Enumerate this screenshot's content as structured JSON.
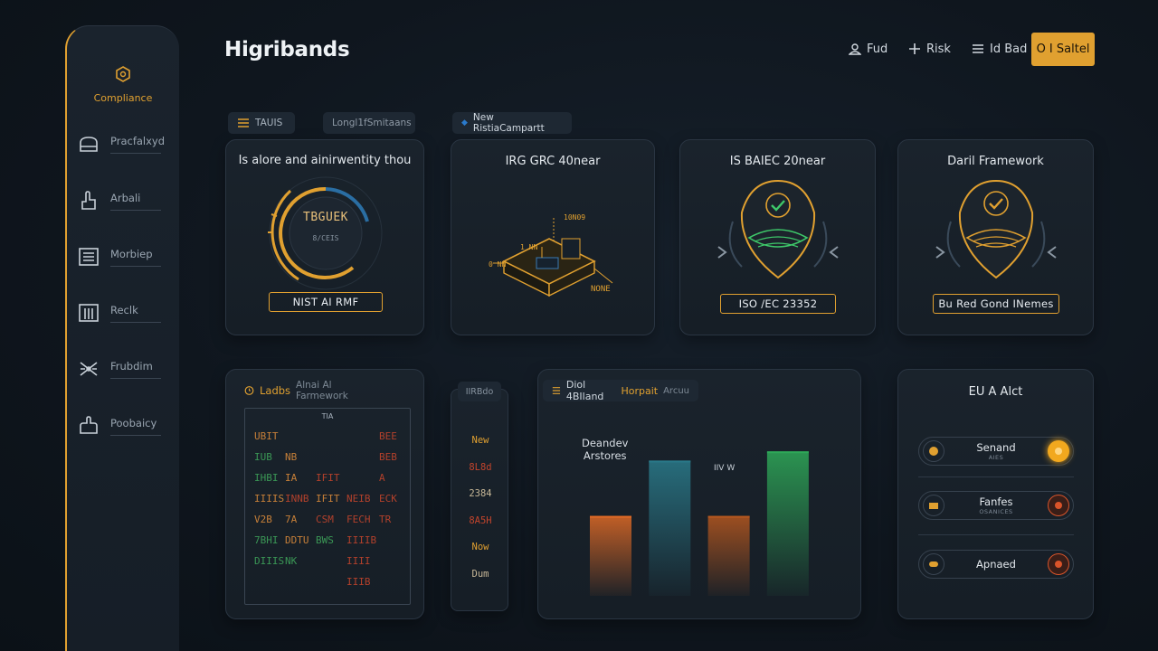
{
  "app": {
    "brand": "Higribands"
  },
  "sidebar": {
    "logo_label": "Compliance",
    "items": [
      {
        "label": "Pracfalxyd",
        "icon": "sofa-icon"
      },
      {
        "label": "Arbali",
        "icon": "hand-icon"
      },
      {
        "label": "Morbiep",
        "icon": "list-icon"
      },
      {
        "label": "Reclk",
        "icon": "bars-icon"
      },
      {
        "label": "Frubdim",
        "icon": "network-icon"
      },
      {
        "label": "Poobaicy",
        "icon": "hand-stop-icon"
      }
    ]
  },
  "topnav": {
    "items": [
      {
        "label": "Fud",
        "icon": "user-icon"
      },
      {
        "label": "Risk",
        "icon": "plus-icon"
      },
      {
        "label": "Id Bad",
        "icon": "menu-icon"
      }
    ],
    "signin_label": "O I Saltel"
  },
  "cards": {
    "nist": {
      "tab1": "TAUIS",
      "tab2": "Longl1fSmitaans",
      "title": "Is alore and ainirwentity thou",
      "gauge_main": "TBGUEK",
      "gauge_sub": "8/CEIS",
      "badge": "NIST AI RMF"
    },
    "irg": {
      "tab": "New RistiaCampartt",
      "title": "IRG GRC 40near",
      "labels": [
        "10N09",
        "1 NN",
        "0 NN",
        "NONE"
      ]
    },
    "isbaiec": {
      "title": "IS BAIEC 20near",
      "badge": "ISO /EC 23352"
    },
    "daril": {
      "title": "Daril Framework",
      "badge": "Bu Red Gond INemes"
    },
    "ladbs": {
      "tab": "Ladbs",
      "tab_sub": "Alnai Al Farmework",
      "table_header": "TIA",
      "rows": [
        [
          {
            "t": "UBIT",
            "c": "#d98a3a"
          },
          {
            "t": "",
            "c": "#d98a3a"
          },
          {
            "t": "",
            "c": "#d98a3a"
          },
          {
            "t": "",
            "c": "#d98a3a"
          },
          {
            "t": "BEE",
            "c": "#c2442c"
          }
        ],
        [
          {
            "t": "IUB",
            "c": "#3ea35a"
          },
          {
            "t": "NB",
            "c": "#d98a3a"
          },
          {
            "t": "",
            "c": "#d98a3a"
          },
          {
            "t": "",
            "c": "#d98a3a"
          },
          {
            "t": "BEB",
            "c": "#c2442c"
          }
        ],
        [
          {
            "t": "IHBI",
            "c": "#3ea35a"
          },
          {
            "t": "IA",
            "c": "#d98a3a"
          },
          {
            "t": "IFIT",
            "c": "#c2442c"
          },
          {
            "t": "",
            "c": "#d98a3a"
          },
          {
            "t": "A",
            "c": "#c2442c"
          }
        ],
        [
          {
            "t": "IIIIS",
            "c": "#d98a3a"
          },
          {
            "t": "INNB",
            "c": "#c2442c"
          },
          {
            "t": "IFIT",
            "c": "#d98a3a"
          },
          {
            "t": "NEIB",
            "c": "#c2442c"
          },
          {
            "t": "ECK",
            "c": "#c2442c"
          }
        ],
        [
          {
            "t": "V2B",
            "c": "#d98a3a"
          },
          {
            "t": "7A",
            "c": "#d98a3a"
          },
          {
            "t": "CSM",
            "c": "#c2442c"
          },
          {
            "t": "FECH",
            "c": "#c2442c"
          },
          {
            "t": "TR",
            "c": "#c2442c"
          }
        ],
        [
          {
            "t": "7BHI",
            "c": "#3ea35a"
          },
          {
            "t": "DDTU",
            "c": "#d98a3a"
          },
          {
            "t": "BWS",
            "c": "#3ea35a"
          },
          {
            "t": "IIIIB",
            "c": "#c2442c"
          },
          {
            "t": "",
            "c": "#c2442c"
          }
        ],
        [
          {
            "t": "DIIIS",
            "c": "#3ea35a"
          },
          {
            "t": "NK",
            "c": "#3ea35a"
          },
          {
            "t": "",
            "c": "#c2442c"
          },
          {
            "t": "IIII",
            "c": "#c2442c"
          },
          {
            "t": "",
            "c": "#c2442c"
          }
        ],
        [
          {
            "t": "",
            "c": "#c2442c"
          },
          {
            "t": "",
            "c": "#c2442c"
          },
          {
            "t": "",
            "c": "#c2442c"
          },
          {
            "t": "IIIB",
            "c": "#c2442c"
          },
          {
            "t": "",
            "c": "#c2442c"
          }
        ]
      ]
    },
    "col": {
      "tab": "IIRBdo",
      "items": [
        {
          "t": "New",
          "c": "#e0a030"
        },
        {
          "t": "8L8d",
          "c": "#c2442c"
        },
        {
          "t": "2384",
          "c": "#c8b898"
        },
        {
          "t": "8A5H",
          "c": "#c2442c"
        },
        {
          "t": "Now",
          "c": "#e0a030"
        },
        {
          "t": "Dum",
          "c": "#c8b898"
        }
      ]
    },
    "chart": {
      "tab": "Diol 4BIland",
      "tab_accent": "Horpait",
      "tab_tail": "Arcuu",
      "legend_l1": "Deandev",
      "legend_l2": "Arstores",
      "mid_label": "IIV W",
      "bars": [
        {
          "value": 0.52,
          "color": "#e06a26"
        },
        {
          "value": 0.88,
          "color": "#2a7a8a"
        },
        {
          "value": 0.52,
          "color": "#b5571f"
        },
        {
          "value": 0.94,
          "color": "#2ea858"
        }
      ]
    },
    "eu": {
      "title": "EU A Alct",
      "alerts": [
        {
          "main": "Senand",
          "sub": "AIES",
          "left_color": "#e0a030",
          "right_color": "#f2a81e"
        },
        {
          "main": "Fanfes",
          "sub": "OSANICES",
          "left_color": "#e0a030",
          "right_color": "#d9542a"
        },
        {
          "main": "Apnaed",
          "sub": "",
          "left_color": "#e0a030",
          "right_color": "#d9542a"
        }
      ]
    }
  }
}
